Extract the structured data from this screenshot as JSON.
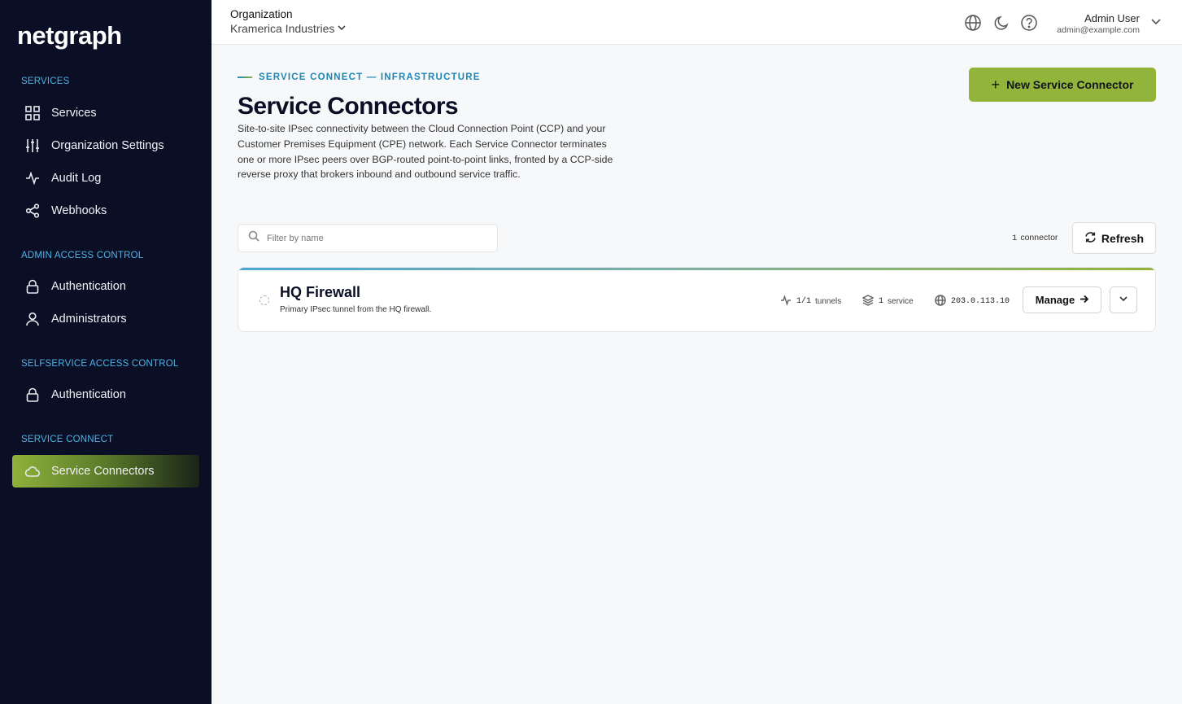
{
  "app": {
    "logo": "netgraph"
  },
  "sidebar": {
    "sections": [
      {
        "title": "SERVICES",
        "items": [
          {
            "label": "Services",
            "icon": "grid-icon"
          },
          {
            "label": "Organization Settings",
            "icon": "sliders-icon"
          },
          {
            "label": "Audit Log",
            "icon": "activity-icon"
          },
          {
            "label": "Webhooks",
            "icon": "share-icon"
          }
        ]
      },
      {
        "title": "ADMIN ACCESS CONTROL",
        "items": [
          {
            "label": "Authentication",
            "icon": "lock-icon"
          },
          {
            "label": "Administrators",
            "icon": "user-icon"
          }
        ]
      },
      {
        "title": "SELFSERVICE ACCESS CONTROL",
        "items": [
          {
            "label": "Authentication",
            "icon": "lock-icon"
          }
        ]
      },
      {
        "title": "SERVICE CONNECT",
        "items": [
          {
            "label": "Service Connectors",
            "icon": "cloud-icon",
            "active": true
          }
        ]
      }
    ]
  },
  "topbar": {
    "org_label": "Organization",
    "org_name": "Kramerica Industries",
    "user_name": "Admin User",
    "user_email": "admin@example.com"
  },
  "main": {
    "eyebrow": "SERVICE CONNECT — INFRASTRUCTURE",
    "title": "Service Connectors",
    "description": "Site-to-site IPsec connectivity between the Cloud Connection Point (CCP) and your Customer Premises Equipment (CPE) network. Each Service Connector terminates one or more IPsec peers over BGP-routed point-to-point links, fronted by a CCP-side reverse proxy that brokers inbound and outbound service traffic.",
    "new_button": "New Service Connector",
    "filter_placeholder": "Filter by name",
    "count_value": "1",
    "count_label": "connector",
    "refresh_label": "Refresh",
    "connectors": [
      {
        "name": "HQ Firewall",
        "description": "Primary IPsec tunnel from the HQ firewall.",
        "tunnels_value": "1/1",
        "tunnels_label": "tunnels",
        "services_value": "1",
        "services_label": "service",
        "ip": "203.0.113.10",
        "manage_label": "Manage"
      }
    ]
  },
  "colors": {
    "sidebar_bg": "#0b0f26",
    "accent_green": "#93b43a",
    "accent_blue": "#1f86b5"
  }
}
